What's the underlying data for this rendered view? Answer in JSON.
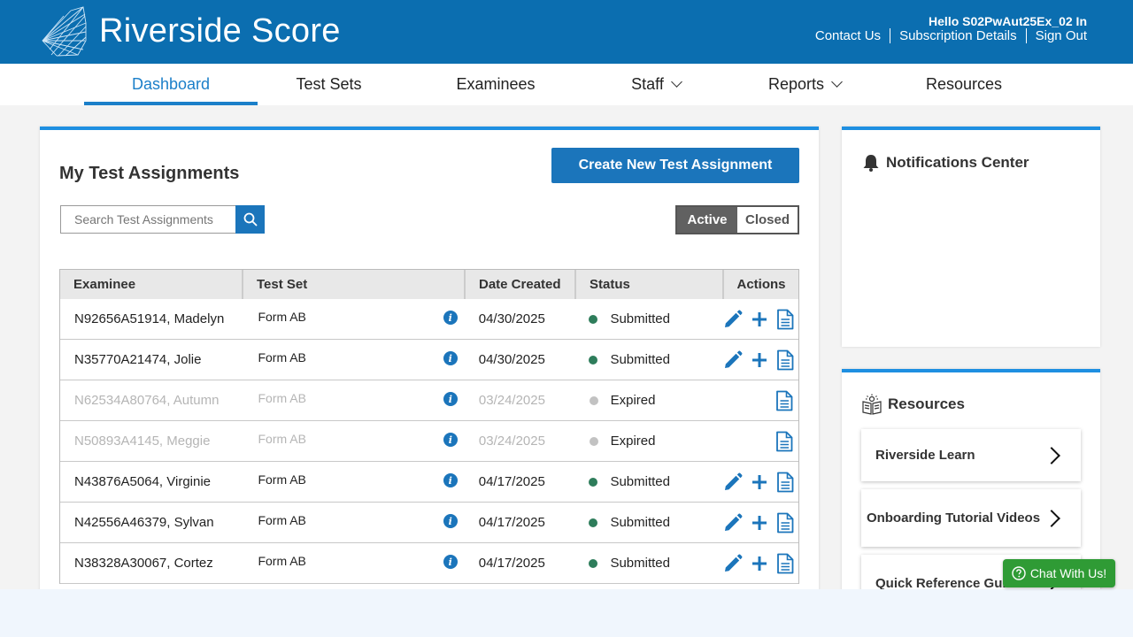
{
  "header": {
    "brand": "Riverside Score",
    "greeting": "Hello S02PwAut25Ex_02 In",
    "links": [
      "Contact Us",
      "Subscription Details",
      "Sign Out"
    ]
  },
  "nav": {
    "items": [
      {
        "label": "Dashboard",
        "active": true
      },
      {
        "label": "Test Sets"
      },
      {
        "label": "Examinees"
      },
      {
        "label": "Staff",
        "dropdown": true
      },
      {
        "label": "Reports",
        "dropdown": true
      },
      {
        "label": "Resources"
      }
    ]
  },
  "assignments": {
    "title": "My Test Assignments",
    "create_label": "Create New Test Assignment",
    "search_placeholder": "Search Test Assignments",
    "toggle": {
      "active": "Active",
      "closed": "Closed"
    },
    "columns": [
      "Examinee",
      "Test Set",
      "Date Created",
      "Status",
      "Actions"
    ],
    "rows": [
      {
        "examinee": "N92656A51914, Madelyn",
        "test_set": "Form AB",
        "date": "04/30/2025",
        "status": "Submitted"
      },
      {
        "examinee": "N35770A21474, Jolie",
        "test_set": "Form AB",
        "date": "04/30/2025",
        "status": "Submitted"
      },
      {
        "examinee": "N62534A80764, Autumn",
        "test_set": "Form AB",
        "date": "03/24/2025",
        "status": "Expired"
      },
      {
        "examinee": "N50893A4145, Meggie",
        "test_set": "Form AB",
        "date": "03/24/2025",
        "status": "Expired"
      },
      {
        "examinee": "N43876A5064, Virginie",
        "test_set": "Form AB",
        "date": "04/17/2025",
        "status": "Submitted"
      },
      {
        "examinee": "N42556A46379, Sylvan",
        "test_set": "Form AB",
        "date": "04/17/2025",
        "status": "Submitted"
      },
      {
        "examinee": "N38328A30067, Cortez",
        "test_set": "Form AB",
        "date": "04/17/2025",
        "status": "Submitted"
      }
    ]
  },
  "notifications": {
    "title": "Notifications Center"
  },
  "resources": {
    "title": "Resources",
    "items": [
      "Riverside Learn",
      "Onboarding Tutorial Videos",
      "Quick Reference Guide"
    ]
  },
  "chat": {
    "label": "Chat With Us!"
  },
  "colors": {
    "brand": "#0b6eb0",
    "accent": "#1b75bb",
    "submitted": "#2e7d5b",
    "expired": "#c2c2c2",
    "chat": "#2f9b35"
  }
}
